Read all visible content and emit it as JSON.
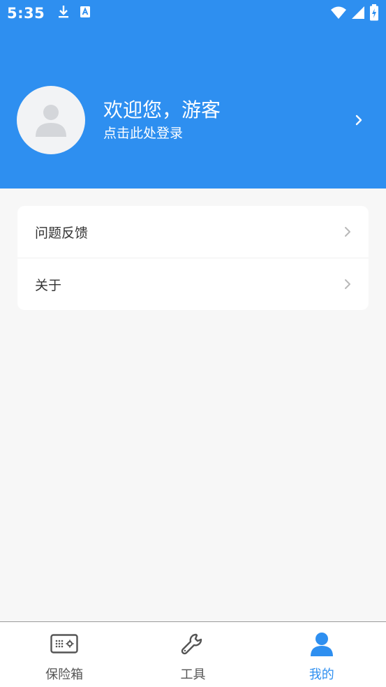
{
  "status_bar": {
    "time": "5:35",
    "icons": [
      "download-icon",
      "a11y-icon",
      "wifi-icon",
      "signal-icon",
      "battery-charging-icon"
    ]
  },
  "profile": {
    "welcome_text": "欢迎您，游客",
    "login_hint": "点击此处登录"
  },
  "menu": {
    "items": [
      {
        "label": "问题反馈"
      },
      {
        "label": "关于"
      }
    ]
  },
  "tabbar": {
    "tabs": [
      {
        "label": "保险箱",
        "icon": "safe-icon",
        "active": false
      },
      {
        "label": "工具",
        "icon": "wrench-icon",
        "active": false
      },
      {
        "label": "我的",
        "icon": "person-icon",
        "active": true
      }
    ]
  },
  "colors": {
    "primary": "#2e8ff0",
    "background": "#f7f7f7",
    "text": "#333333",
    "inactive": "#555555"
  }
}
